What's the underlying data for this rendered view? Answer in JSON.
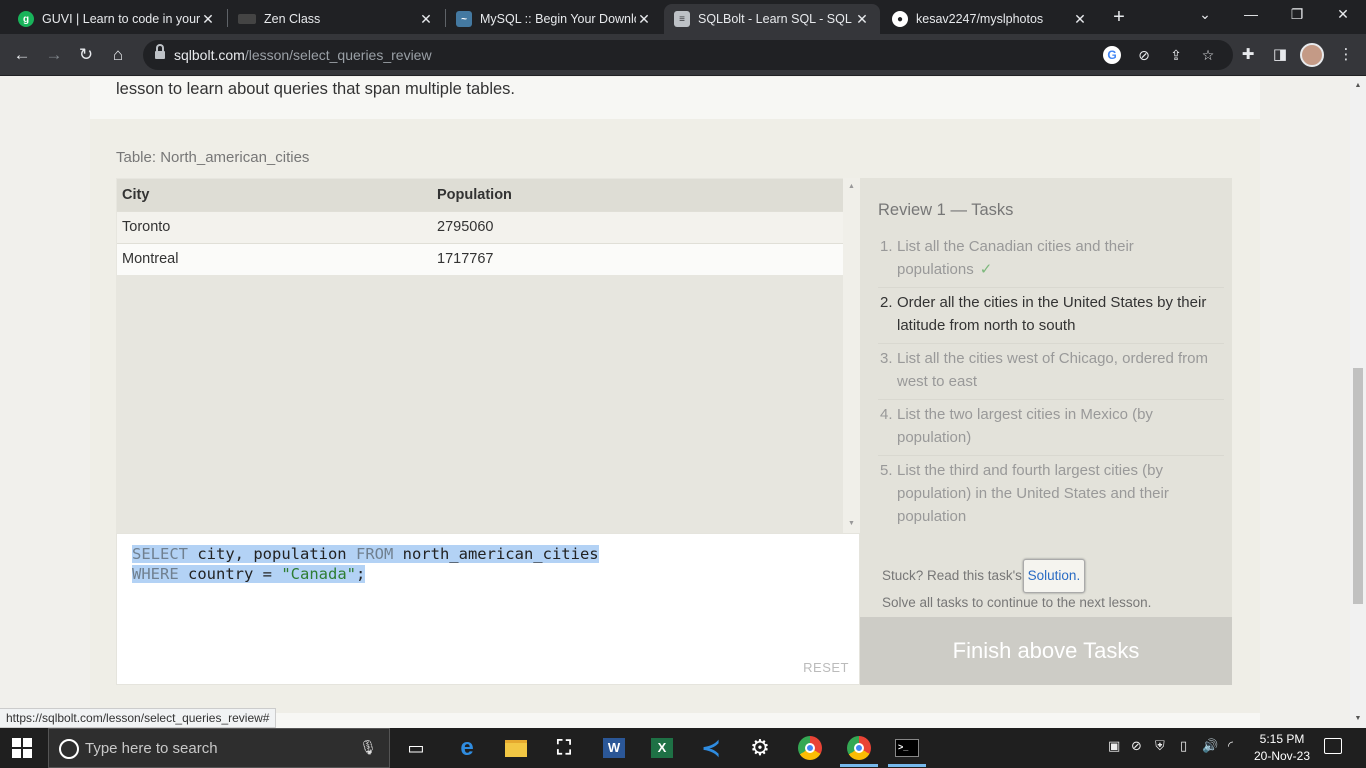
{
  "browser": {
    "tabs": [
      {
        "title": "GUVI | Learn to code in your",
        "favicon": "guvi-icon",
        "favicon_color": "#18b35a",
        "active": false
      },
      {
        "title": "Zen Class",
        "favicon": "zen-icon",
        "favicon_color": "#555555",
        "active": false
      },
      {
        "title": "MySQL :: Begin Your Downlo",
        "favicon": "mysql-icon",
        "favicon_color": "#4479a1",
        "active": false
      },
      {
        "title": "SQLBolt - Learn SQL - SQL R",
        "favicon": "database-icon",
        "favicon_color": "#bdc1c6",
        "active": true
      },
      {
        "title": "kesav2247/myslphotos",
        "favicon": "github-icon",
        "favicon_color": "#ffffff",
        "active": false
      }
    ],
    "url_host": "sqlbolt.com",
    "url_path": "/lesson/select_queries_review"
  },
  "page": {
    "intro_text": "lesson to learn about queries that span multiple tables.",
    "table_caption": "Table: North_american_cities",
    "table": {
      "headers": [
        "City",
        "Population"
      ],
      "rows": [
        [
          "Toronto",
          "2795060"
        ],
        [
          "Montreal",
          "1717767"
        ]
      ]
    },
    "query_lines": [
      {
        "kw1": "SELECT",
        "t1": " city, population ",
        "kw2": "FROM",
        "t2": " north_american_cities",
        "str": "",
        "end": ""
      },
      {
        "kw1": "WHERE",
        "t1": " country = ",
        "kw2": "",
        "t2": "",
        "str": "\"Canada\"",
        "end": ";"
      }
    ],
    "reset_label": "RESET",
    "tasks_title": "Review 1 — Tasks",
    "tasks": [
      {
        "num": "1.",
        "text": "List all the Canadian cities and their populations",
        "status": "done"
      },
      {
        "num": "2.",
        "text": "Order all the cities in the United States by their latitude from north to south",
        "status": "current"
      },
      {
        "num": "3.",
        "text": "List all the cities west of Chicago, ordered from west to east",
        "status": "pending"
      },
      {
        "num": "4.",
        "text": "List the two largest cities in Mexico (by population)",
        "status": "pending"
      },
      {
        "num": "5.",
        "text": "List the third and fourth largest cities (by population) in the United States and their population",
        "status": "pending"
      }
    ],
    "check_mark": "✓",
    "stuck_text": "Stuck? Read this task's ",
    "solution_link": "Solution.",
    "solve_text": "Solve all tasks to continue to the next lesson.",
    "finish_button": "Finish above Tasks"
  },
  "status_url": "https://sqlbolt.com/lesson/select_queries_review#",
  "taskbar": {
    "search_placeholder": "Type here to search",
    "time": "5:15 PM",
    "date": "20-Nov-23"
  }
}
